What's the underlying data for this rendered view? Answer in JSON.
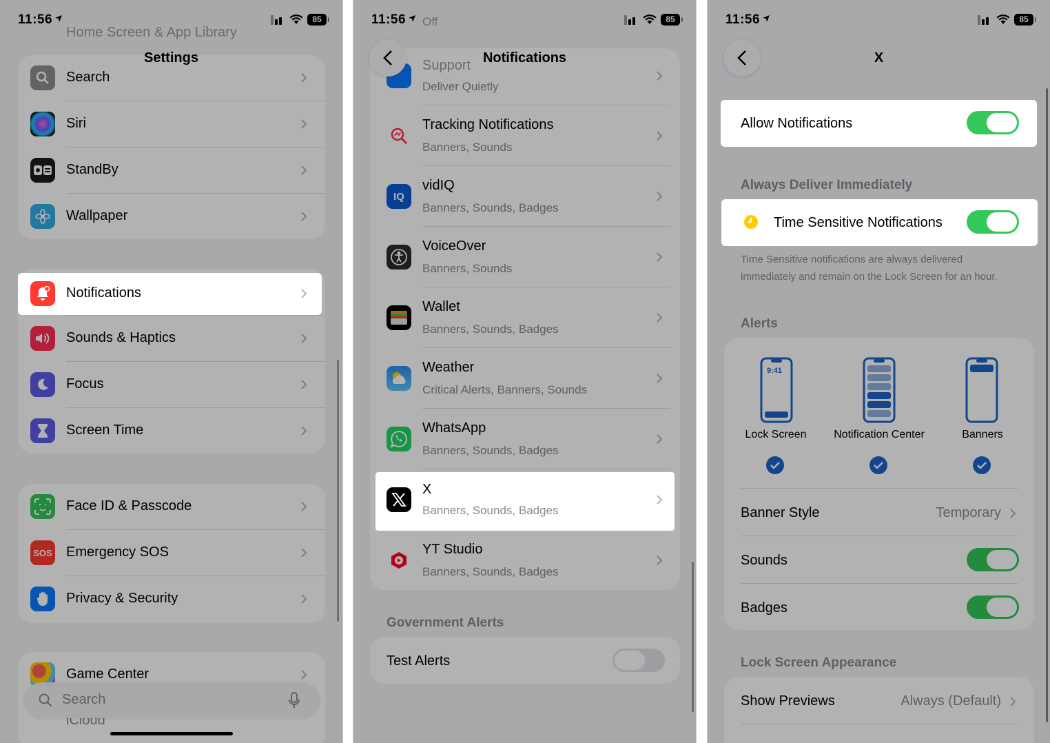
{
  "status": {
    "time": "11:56",
    "battery": "85"
  },
  "panel1": {
    "title": "Settings",
    "faded_top": "Home Screen & App Library",
    "items": [
      {
        "label": "Search"
      },
      {
        "label": "Siri"
      },
      {
        "label": "StandBy"
      },
      {
        "label": "Wallpaper"
      },
      {
        "label": "Notifications"
      },
      {
        "label": "Sounds & Haptics"
      },
      {
        "label": "Focus"
      },
      {
        "label": "Screen Time"
      },
      {
        "label": "Face ID & Passcode"
      },
      {
        "label": "Emergency SOS"
      },
      {
        "label": "Privacy & Security"
      },
      {
        "label": "Game Center"
      },
      {
        "label": "iCloud"
      }
    ],
    "search_placeholder": "Search",
    "sos_glyph": "SOS"
  },
  "panel2": {
    "title": "Notifications",
    "faded_top_sub": "Off",
    "apps": [
      {
        "name": "Support",
        "sub": "Deliver Quietly"
      },
      {
        "name": "Tracking Notifications",
        "sub": "Banners, Sounds"
      },
      {
        "name": "vidIQ",
        "sub": "Banners, Sounds, Badges"
      },
      {
        "name": "VoiceOver",
        "sub": "Banners, Sounds"
      },
      {
        "name": "Wallet",
        "sub": "Banners, Sounds, Badges"
      },
      {
        "name": "Weather",
        "sub": "Critical Alerts, Banners, Sounds"
      },
      {
        "name": "WhatsApp",
        "sub": "Banners, Sounds, Badges"
      },
      {
        "name": "X",
        "sub": "Banners, Sounds, Badges"
      },
      {
        "name": "YT Studio",
        "sub": "Banners, Sounds, Badges"
      }
    ],
    "vidiq_glyph": "IQ",
    "gov_header": "Government Alerts",
    "test_alerts": "Test Alerts",
    "test_alerts_on": false
  },
  "panel3": {
    "title": "X",
    "allow_notifications": "Allow Notifications",
    "allow_on": true,
    "always_header": "Always Deliver Immediately",
    "time_sensitive": "Time Sensitive Notifications",
    "time_sensitive_on": true,
    "footnote": "Time Sensitive notifications are always delivered immediately and remain on the Lock Screen for an hour.",
    "alerts_header": "Alerts",
    "alert_styles": [
      {
        "label": "Lock Screen",
        "checked": true,
        "clock": "9:41"
      },
      {
        "label": "Notification Center",
        "checked": true
      },
      {
        "label": "Banners",
        "checked": true
      }
    ],
    "banner_style_label": "Banner Style",
    "banner_style_value": "Temporary",
    "sounds_label": "Sounds",
    "sounds_on": true,
    "badges_label": "Badges",
    "badges_on": true,
    "lock_header": "Lock Screen Appearance",
    "show_previews_label": "Show Previews",
    "show_previews_value": "Always (Default)"
  },
  "colors": {
    "green": "#34c759",
    "blue": "#0a7aff",
    "red": "#ff3b30",
    "accent_blue": "#1c63c9"
  }
}
